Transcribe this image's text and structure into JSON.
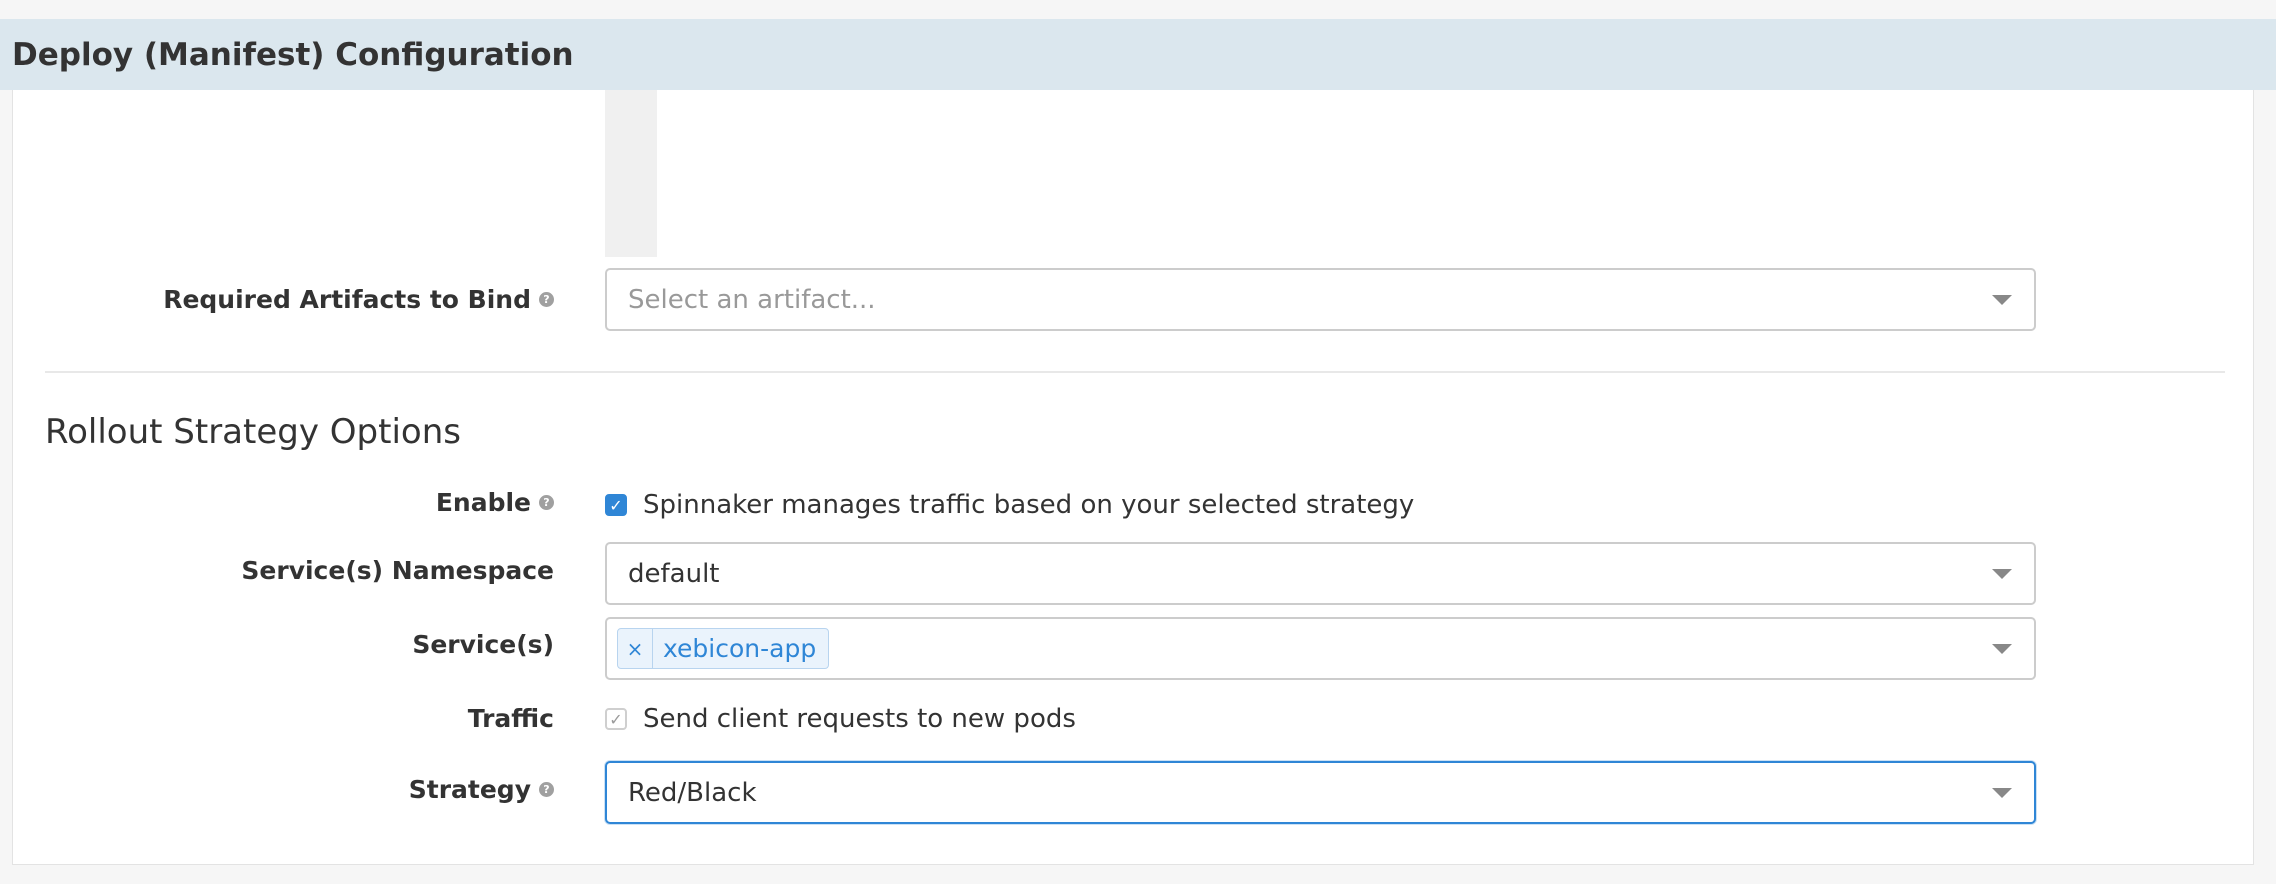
{
  "header": {
    "title": "Deploy (Manifest) Configuration"
  },
  "required_artifacts": {
    "label": "Required Artifacts to Bind",
    "placeholder": "Select an artifact..."
  },
  "rollout": {
    "heading": "Rollout Strategy Options",
    "enable": {
      "label": "Enable",
      "checked": true,
      "text": "Spinnaker manages traffic based on your selected strategy"
    },
    "namespace": {
      "label": "Service(s) Namespace",
      "value": "default"
    },
    "services": {
      "label": "Service(s)",
      "tags": [
        "xebicon-app"
      ],
      "remove_glyph": "×"
    },
    "traffic": {
      "label": "Traffic",
      "checked": true,
      "text": "Send client requests to new pods"
    },
    "strategy": {
      "label": "Strategy",
      "value": "Red/Black"
    }
  },
  "icons": {
    "help": "help-icon",
    "dropdown": "chevron-down-icon",
    "check": "check-icon",
    "remove": "close-icon"
  },
  "colors": {
    "header_bg": "#dbe7ee",
    "accent": "#2f86d6",
    "tag_bg": "#eaf3fc",
    "border": "#cccccc"
  }
}
